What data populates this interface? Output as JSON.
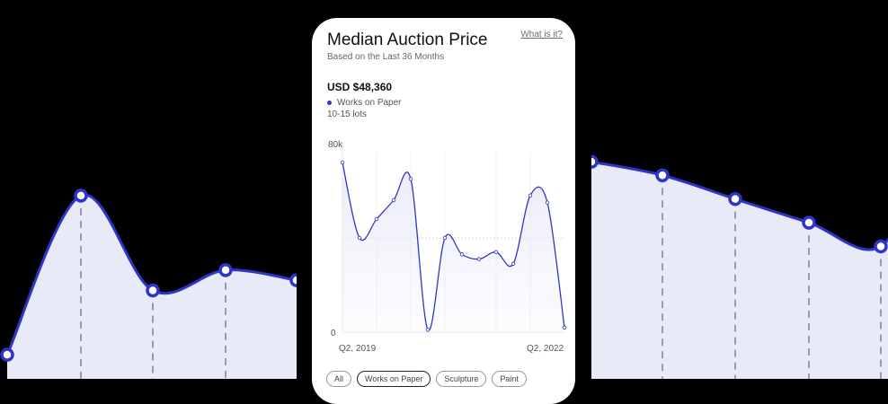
{
  "colors": {
    "accent": "#2f35c8",
    "fill": "#e9eaf8",
    "background": "#000000",
    "card": "#ffffff"
  },
  "card": {
    "title": "Median Auction Price",
    "link": "What is it?",
    "subtitle": "Based on the Last 36 Months",
    "price": "USD $48,360",
    "legend": "Works on Paper",
    "lots": "10-15 lots",
    "tabs": [
      "All",
      "Works on Paper",
      "Sculpture",
      "Paint"
    ]
  },
  "chart_data": [
    {
      "type": "line",
      "x_tick_labels": [
        "Q2, 2019",
        "Q2, 2022"
      ],
      "y_tick_labels": [
        "80k",
        "0"
      ],
      "ylim": [
        0,
        80000
      ],
      "series": [
        {
          "name": "Works on Paper",
          "values": [
            72000,
            40000,
            48000,
            56000,
            65000,
            1000,
            40000,
            33000,
            31000,
            34000,
            29000,
            58000,
            55000,
            2000
          ]
        }
      ],
      "grid": true
    },
    {
      "type": "line",
      "series": [
        {
          "values": [
            5,
            52,
            24,
            30,
            27
          ]
        }
      ],
      "ylim": [
        0,
        70
      ]
    },
    {
      "type": "line",
      "series": [
        {
          "values": [
            62,
            58,
            51,
            44,
            37,
            67
          ]
        }
      ],
      "ylim": [
        0,
        70
      ]
    }
  ]
}
